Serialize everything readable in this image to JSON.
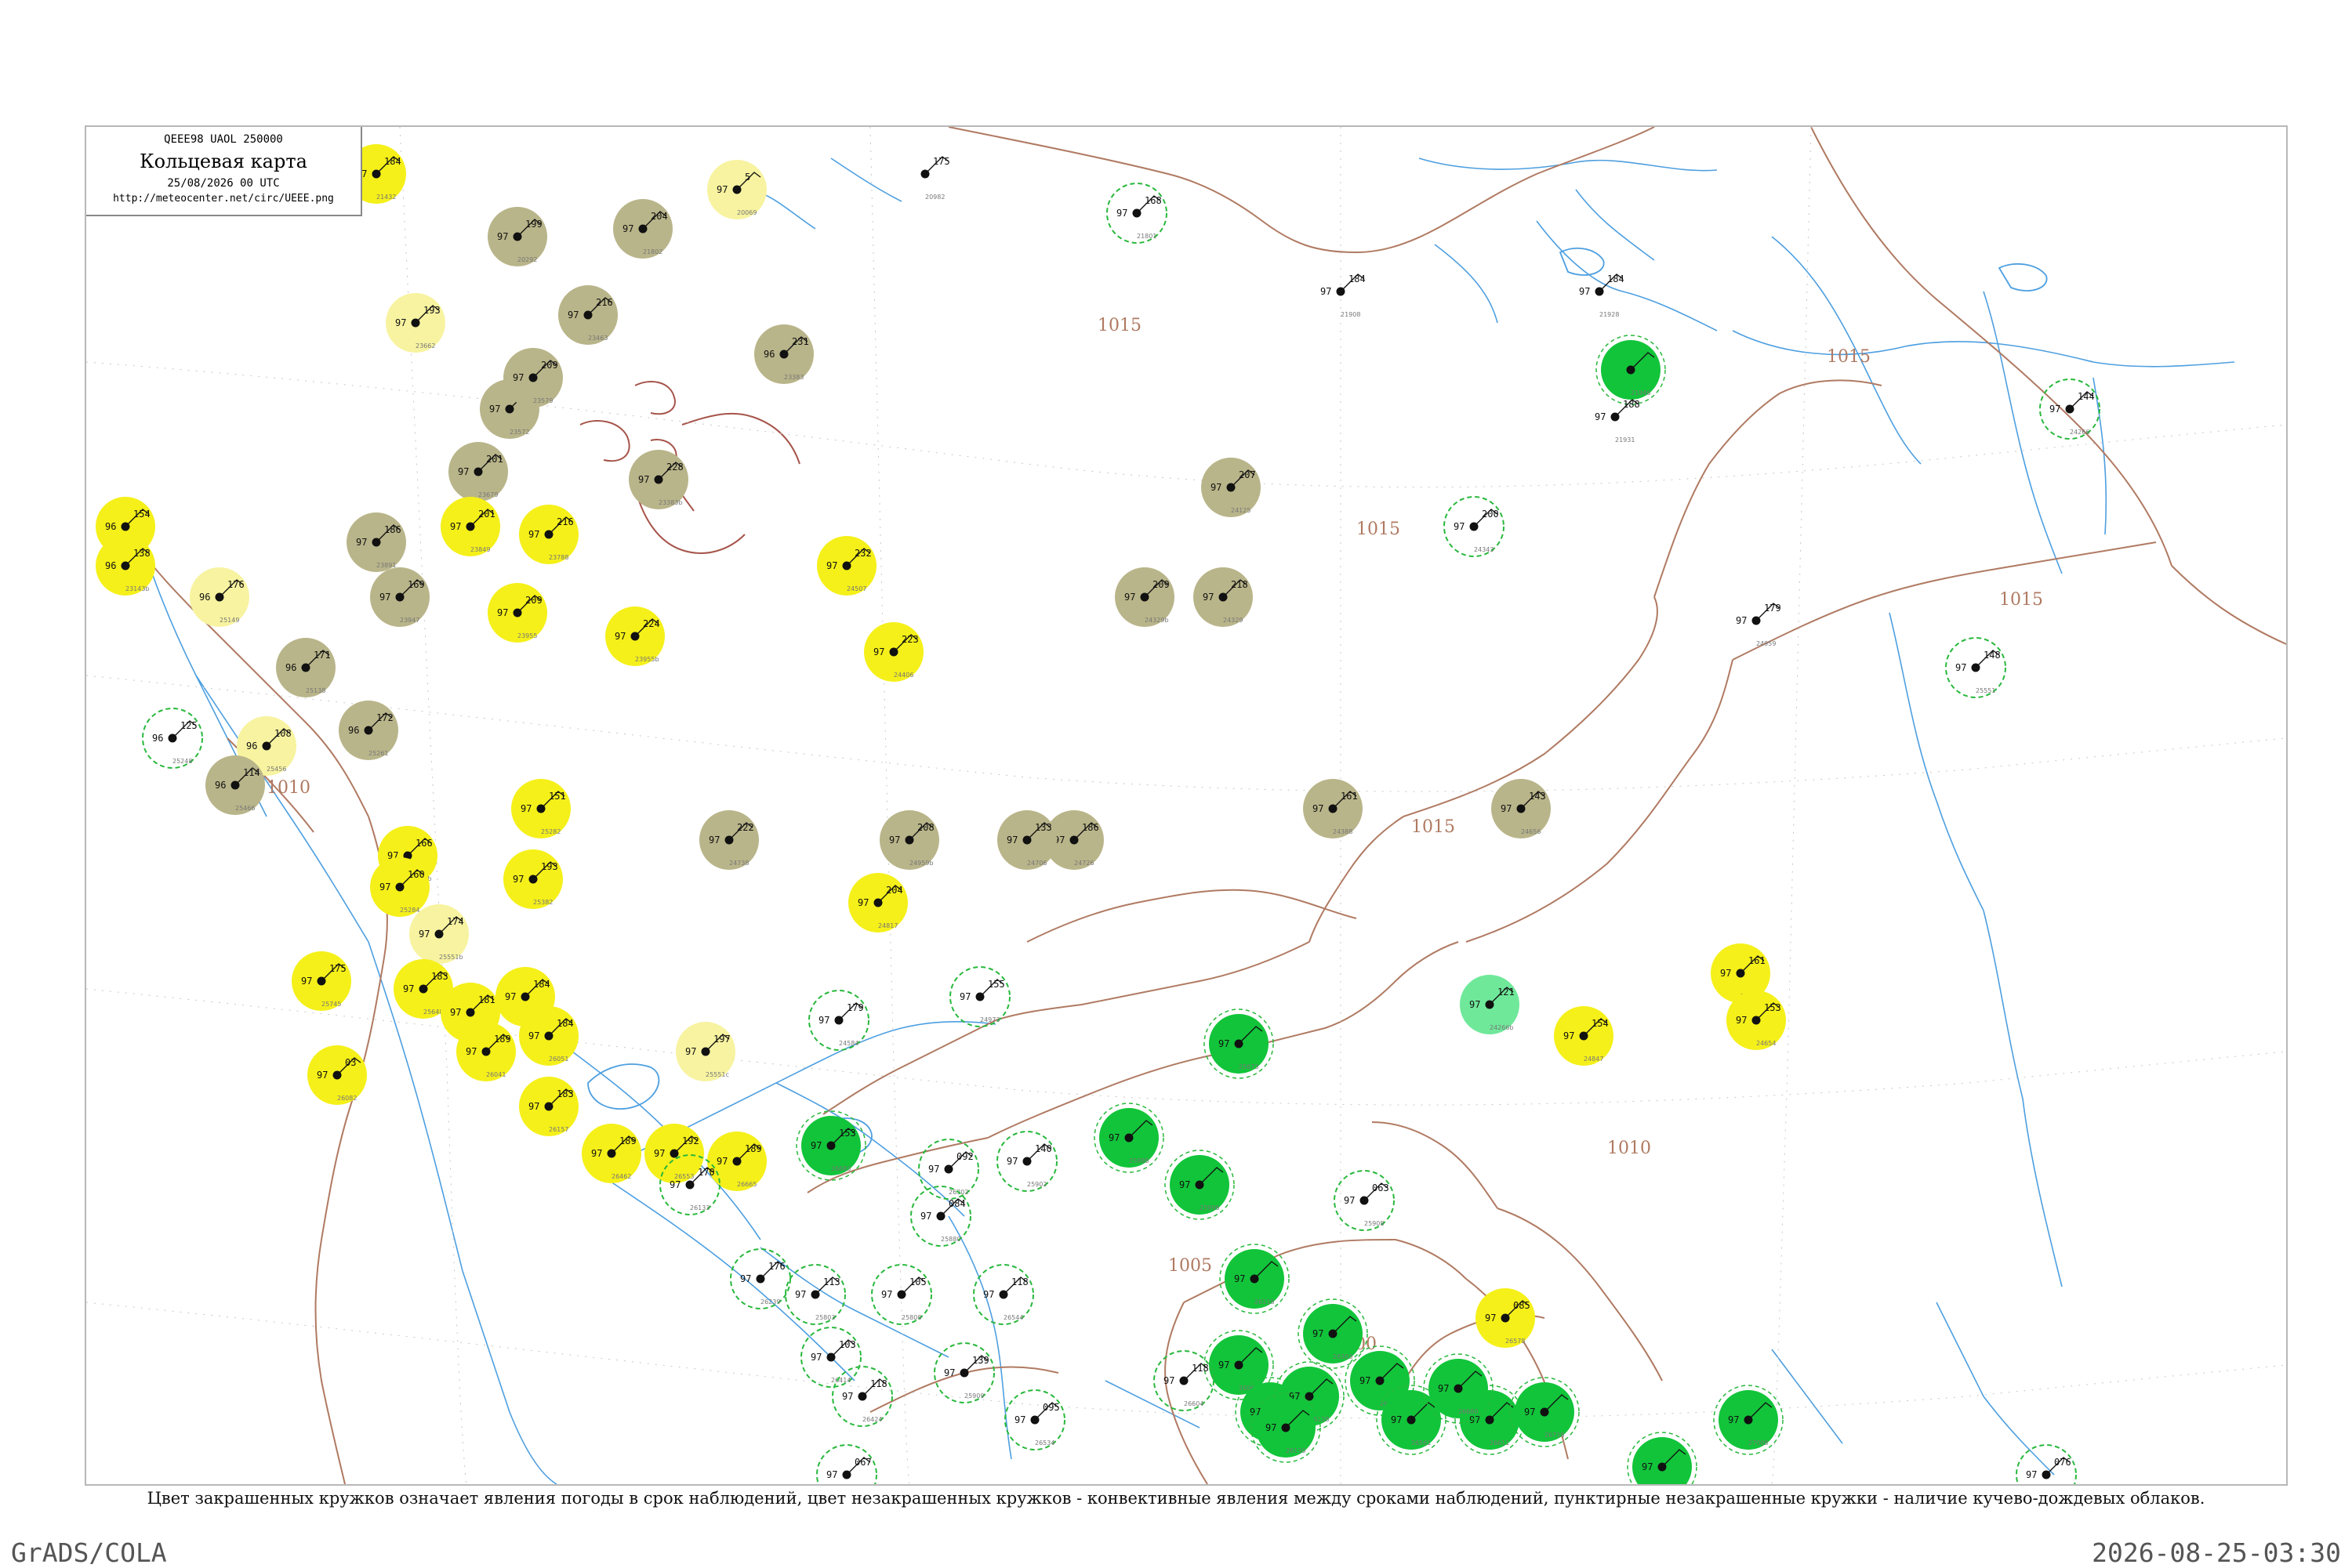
{
  "header": {
    "code_line": "QEEE98  UAOL  250000",
    "title": "Кольцевая карта",
    "date_line": "25/08/2026 00 UTC",
    "url": "http://meteocenter.net/circ/UEEE.png"
  },
  "caption": "Цвет закрашенных кружков означает явления погоды в срок наблюдений, цвет незакрашенных кружков - конвективные явления между сроками наблюдений, пунктирные незакрашенные кружки - наличие кучево-дождевых облаков.",
  "footer": {
    "left": "GrADS/COLA",
    "right": "2026-08-25-03:30"
  },
  "colors": {
    "yellow": "#f5f019",
    "pale_yellow": "#f7f3a0",
    "olive": "#b9b58a",
    "green": "#12c43a",
    "light_green": "#6fe89a",
    "ring": "#28b83c",
    "isobar": "#b07a62",
    "water": "#4d9fe0"
  },
  "isobar_labels": [
    "1015",
    "1015",
    "1015",
    "1015",
    "1010",
    "1010",
    "1005",
    "1000",
    "1015"
  ],
  "stations": [
    {
      "id": "21432",
      "t": "97",
      "p": "184",
      "s": "yellow"
    },
    {
      "id": "20292",
      "t": "97",
      "p": "199",
      "s": "olive"
    },
    {
      "id": "21802",
      "t": "97",
      "p": "204",
      "s": "olive"
    },
    {
      "id": "20069",
      "t": "97",
      "p": "5",
      "s": "pale_yellow"
    },
    {
      "id": "21801",
      "t": "97",
      "p": "168",
      "s": "ring"
    },
    {
      "id": "20982",
      "t": "",
      "p": "175",
      "s": "none"
    },
    {
      "id": "23662",
      "t": "97",
      "p": "193",
      "s": "pale_yellow"
    },
    {
      "id": "23463",
      "t": "97",
      "p": "216",
      "s": "olive"
    },
    {
      "id": "23383",
      "t": "96",
      "p": "231",
      "s": "olive"
    },
    {
      "id": "23572",
      "t": "97",
      "p": "207",
      "s": "olive"
    },
    {
      "id": "23579",
      "t": "97",
      "p": "209",
      "s": "olive"
    },
    {
      "id": "23679",
      "t": "97",
      "p": "201",
      "s": "olive"
    },
    {
      "id": "23849",
      "t": "97",
      "p": "201",
      "s": "yellow"
    },
    {
      "id": "23788",
      "t": "97",
      "p": "216",
      "s": "yellow"
    },
    {
      "id": "23383b",
      "t": "97",
      "p": "228",
      "s": "olive"
    },
    {
      "id": "24125",
      "t": "97",
      "p": "207",
      "s": "olive"
    },
    {
      "id": "24343",
      "t": "97",
      "p": "200",
      "s": "ring"
    },
    {
      "id": "21908",
      "t": "97",
      "p": "184",
      "s": "none"
    },
    {
      "id": "21928",
      "t": "97",
      "p": "184",
      "s": "none"
    },
    {
      "id": "21946",
      "t": "",
      "p": "",
      "s": "green"
    },
    {
      "id": "21931",
      "t": "97",
      "p": "188",
      "s": "none"
    },
    {
      "id": "24266",
      "t": "97",
      "p": "144",
      "s": "ring"
    },
    {
      "id": "24329",
      "t": "97",
      "p": "218",
      "s": "olive"
    },
    {
      "id": "24329b",
      "t": "97",
      "p": "209",
      "s": "olive"
    },
    {
      "id": "23891",
      "t": "97",
      "p": "186",
      "s": "olive"
    },
    {
      "id": "23947",
      "t": "97",
      "p": "169",
      "s": "olive"
    },
    {
      "id": "23955",
      "t": "97",
      "p": "209",
      "s": "yellow"
    },
    {
      "id": "23955b",
      "t": "97",
      "p": "224",
      "s": "yellow"
    },
    {
      "id": "24507",
      "t": "97",
      "p": "232",
      "s": "yellow"
    },
    {
      "id": "24406",
      "t": "97",
      "p": "223",
      "s": "yellow"
    },
    {
      "id": "25551",
      "t": "97",
      "p": "148",
      "s": "ring"
    },
    {
      "id": "24959",
      "t": "97",
      "p": "179",
      "s": "none"
    },
    {
      "id": "23143",
      "t": "96",
      "p": "154",
      "s": "yellow"
    },
    {
      "id": "23143b",
      "t": "96",
      "p": "138",
      "s": "yellow"
    },
    {
      "id": "25149",
      "t": "96",
      "p": "176",
      "s": "pale_yellow"
    },
    {
      "id": "25138",
      "t": "96",
      "p": "171",
      "s": "olive"
    },
    {
      "id": "25261",
      "t": "96",
      "p": "172",
      "s": "olive"
    },
    {
      "id": "25248",
      "t": "96",
      "p": "125",
      "s": "ring"
    },
    {
      "id": "25456",
      "t": "96",
      "p": "108",
      "s": "pale_yellow"
    },
    {
      "id": "25466",
      "t": "96",
      "p": "114",
      "s": "olive"
    },
    {
      "id": "24388",
      "t": "97",
      "p": "161",
      "s": "olive"
    },
    {
      "id": "24656",
      "t": "97",
      "p": "143",
      "s": "olive"
    },
    {
      "id": "24959b",
      "t": "97",
      "p": "208",
      "s": "olive"
    },
    {
      "id": "24738",
      "t": "97",
      "p": "222",
      "s": "olive"
    },
    {
      "id": "24726",
      "t": "97",
      "p": "186",
      "s": "olive"
    },
    {
      "id": "24706",
      "t": "97",
      "p": "133",
      "s": "olive"
    },
    {
      "id": "24817",
      "t": "97",
      "p": "204",
      "s": "yellow"
    },
    {
      "id": "25282",
      "t": "97",
      "p": "151",
      "s": "yellow"
    },
    {
      "id": "25382",
      "t": "97",
      "p": "193",
      "s": "yellow"
    },
    {
      "id": "25282b",
      "t": "97",
      "p": "166",
      "s": "yellow"
    },
    {
      "id": "25284",
      "t": "97",
      "p": "160",
      "s": "yellow"
    },
    {
      "id": "25551b",
      "t": "97",
      "p": "174",
      "s": "pale_yellow"
    },
    {
      "id": "25745",
      "t": "97",
      "p": "175",
      "s": "yellow"
    },
    {
      "id": "25648",
      "t": "97",
      "p": "183",
      "s": "yellow"
    },
    {
      "id": "25642",
      "t": "97",
      "p": "184",
      "s": "yellow"
    },
    {
      "id": "25680",
      "t": "97",
      "p": "181",
      "s": "yellow"
    },
    {
      "id": "26051",
      "t": "97",
      "p": "184",
      "s": "yellow"
    },
    {
      "id": "26041",
      "t": "97",
      "p": "189",
      "s": "yellow"
    },
    {
      "id": "26157",
      "t": "97",
      "p": "183",
      "s": "yellow"
    },
    {
      "id": "26082",
      "t": "97",
      "p": "03",
      "s": "yellow"
    },
    {
      "id": "25551c",
      "t": "97",
      "p": "197",
      "s": "pale_yellow"
    },
    {
      "id": "26462",
      "t": "97",
      "p": "189",
      "s": "yellow"
    },
    {
      "id": "26553",
      "t": "97",
      "p": "192",
      "s": "yellow"
    },
    {
      "id": "26665",
      "t": "97",
      "p": "189",
      "s": "yellow"
    },
    {
      "id": "26683",
      "t": "97",
      "p": "153",
      "s": "green"
    },
    {
      "id": "24583",
      "t": "97",
      "p": "161",
      "s": "yellow"
    },
    {
      "id": "24654",
      "t": "97",
      "p": "153",
      "s": "yellow"
    },
    {
      "id": "24847",
      "t": "97",
      "p": "154",
      "s": "yellow"
    },
    {
      "id": "24266b",
      "t": "97",
      "p": "121",
      "s": "light_green"
    },
    {
      "id": "24584",
      "t": "97",
      "p": "179",
      "s": "ring"
    },
    {
      "id": "24973",
      "t": "97",
      "p": "155",
      "s": "ring"
    },
    {
      "id": "25673",
      "t": "97",
      "p": "",
      "s": "green"
    },
    {
      "id": "25888",
      "t": "97",
      "p": "",
      "s": "green"
    },
    {
      "id": "25996",
      "t": "97",
      "p": "",
      "s": "green"
    },
    {
      "id": "25908",
      "t": "97",
      "p": "063",
      "s": "ring"
    },
    {
      "id": "26118",
      "t": "97",
      "p": "",
      "s": "green"
    },
    {
      "id": "26303",
      "t": "97",
      "p": "",
      "s": "green"
    },
    {
      "id": "26422",
      "t": "97",
      "p": "",
      "s": "green"
    },
    {
      "id": "26561",
      "t": "97",
      "p": "",
      "s": "green"
    },
    {
      "id": "26611",
      "t": "97",
      "p": "",
      "s": "green"
    },
    {
      "id": "26680",
      "t": "97",
      "p": "",
      "s": "green"
    },
    {
      "id": "26718",
      "t": "97",
      "p": "",
      "s": "green"
    },
    {
      "id": "26947",
      "t": "97",
      "p": "",
      "s": "green"
    },
    {
      "id": "27008",
      "t": "97",
      "p": "",
      "s": "green"
    },
    {
      "id": "26064",
      "t": "97",
      "p": "",
      "s": "green"
    },
    {
      "id": "26111",
      "t": "97",
      "p": "",
      "s": "green"
    },
    {
      "id": "26128",
      "t": "97",
      "p": "",
      "s": "green"
    },
    {
      "id": "26130",
      "t": "97",
      "p": "",
      "s": "green"
    },
    {
      "id": "25902",
      "t": "97",
      "p": "140",
      "s": "ring"
    },
    {
      "id": "26302",
      "t": "97",
      "p": "092",
      "s": "ring"
    },
    {
      "id": "25808",
      "t": "97",
      "p": "105",
      "s": "ring"
    },
    {
      "id": "25803",
      "t": "97",
      "p": "113",
      "s": "ring"
    },
    {
      "id": "25909",
      "t": "97",
      "p": "139",
      "s": "ring"
    },
    {
      "id": "25880",
      "t": "97",
      "p": "084",
      "s": "ring"
    },
    {
      "id": "26133",
      "t": "97",
      "p": "170",
      "s": "ring"
    },
    {
      "id": "26239",
      "t": "97",
      "p": "176",
      "s": "ring"
    },
    {
      "id": "26414",
      "t": "97",
      "p": "103",
      "s": "ring"
    },
    {
      "id": "26424",
      "t": "97",
      "p": "118",
      "s": "ring"
    },
    {
      "id": "26534",
      "t": "97",
      "p": "095",
      "s": "ring"
    },
    {
      "id": "26567",
      "t": "97",
      "p": "067",
      "s": "ring"
    },
    {
      "id": "26544",
      "t": "97",
      "p": "118",
      "s": "ring"
    },
    {
      "id": "26604",
      "t": "97",
      "p": "118",
      "s": "ring"
    },
    {
      "id": "26578",
      "t": "97",
      "p": "085",
      "s": "yellow"
    },
    {
      "id": "26676",
      "t": "97",
      "p": "076",
      "s": "ring"
    },
    {
      "id": "26690",
      "t": "97",
      "p": "",
      "s": "ring"
    },
    {
      "id": "26712",
      "t": "97",
      "p": "340",
      "s": "ring"
    }
  ]
}
